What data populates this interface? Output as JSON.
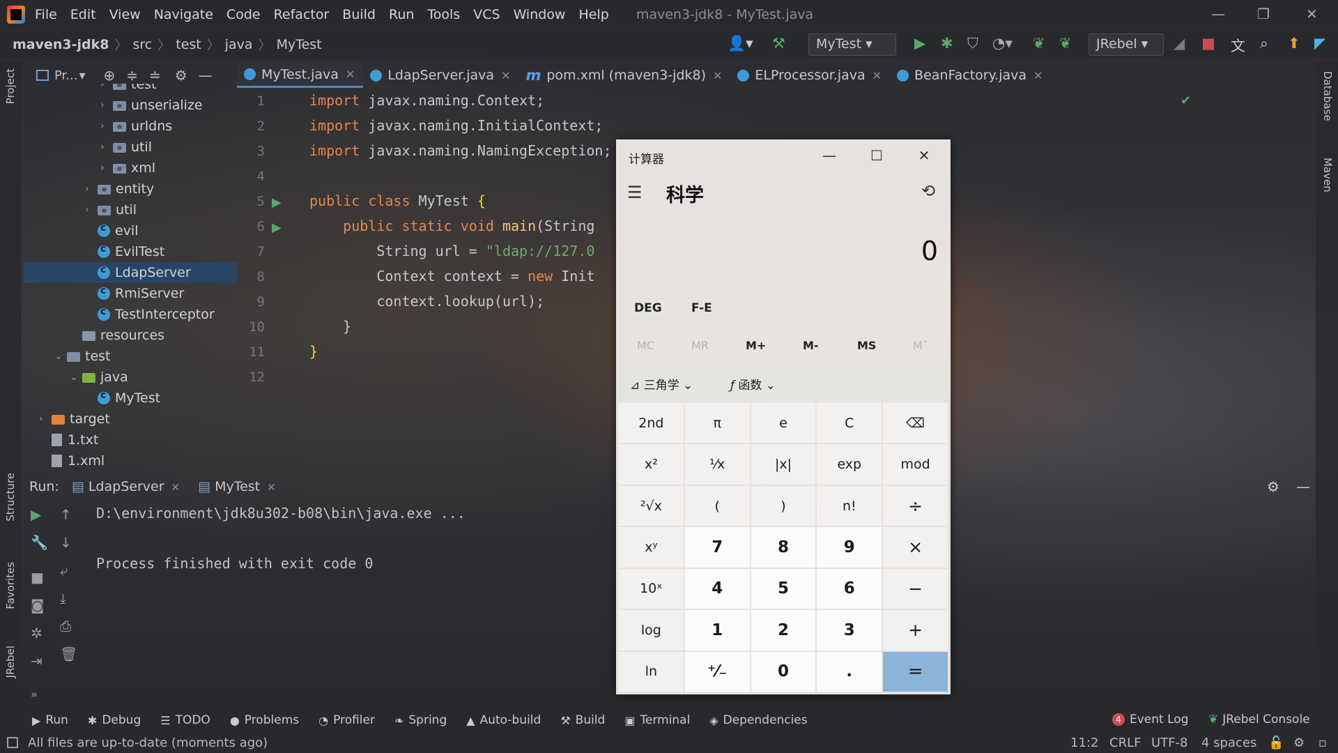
{
  "menubar": {
    "items": [
      "File",
      "Edit",
      "View",
      "Navigate",
      "Code",
      "Refactor",
      "Build",
      "Run",
      "Tools",
      "VCS",
      "Window",
      "Help"
    ],
    "window_title": "maven3-jdk8 - MyTest.java"
  },
  "navbar": {
    "breadcrumbs": [
      "maven3-jdk8",
      "src",
      "test",
      "java",
      "MyTest"
    ],
    "run_config": "MyTest",
    "jrebel_label": "JRebel"
  },
  "left_strip": {
    "project": "Project",
    "structure": "Structure",
    "favorites": "Favorites",
    "jrebel": "JRebel"
  },
  "right_strip": {
    "database": "Database",
    "maven": "Maven"
  },
  "project_panel": {
    "title": "Pr...",
    "tree": [
      {
        "label": "test",
        "kind": "pkg",
        "indent": 3,
        "chev": "›"
      },
      {
        "label": "unserialize",
        "kind": "pkg",
        "indent": 3,
        "chev": "›"
      },
      {
        "label": "urldns",
        "kind": "pkg",
        "indent": 3,
        "chev": "›"
      },
      {
        "label": "util",
        "kind": "pkg",
        "indent": 3,
        "chev": "›"
      },
      {
        "label": "xml",
        "kind": "pkg",
        "indent": 3,
        "chev": "›"
      },
      {
        "label": "entity",
        "kind": "pkg",
        "indent": 2,
        "chev": "›"
      },
      {
        "label": "util",
        "kind": "pkg",
        "indent": 2,
        "chev": "›"
      },
      {
        "label": "evil",
        "kind": "class",
        "indent": 2,
        "chev": ""
      },
      {
        "label": "EvilTest",
        "kind": "class",
        "indent": 2,
        "chev": ""
      },
      {
        "label": "LdapServer",
        "kind": "class",
        "indent": 2,
        "chev": "",
        "selected": true
      },
      {
        "label": "RmiServer",
        "kind": "class",
        "indent": 2,
        "chev": ""
      },
      {
        "label": "TestInterceptor",
        "kind": "class",
        "indent": 2,
        "chev": ""
      },
      {
        "label": "resources",
        "kind": "res",
        "indent": 1,
        "chev": ""
      },
      {
        "label": "test",
        "kind": "folder",
        "indent": 0,
        "chev": "⌄"
      },
      {
        "label": "java",
        "kind": "green",
        "indent": 1,
        "chev": "⌄"
      },
      {
        "label": "MyTest",
        "kind": "class",
        "indent": 2,
        "chev": ""
      },
      {
        "label": "target",
        "kind": "orange",
        "indent": -1,
        "chev": "›"
      },
      {
        "label": "1.txt",
        "kind": "file",
        "indent": -1,
        "chev": ""
      },
      {
        "label": "1.xml",
        "kind": "file",
        "indent": -1,
        "chev": ""
      }
    ]
  },
  "editor": {
    "tabs": [
      {
        "label": "MyTest.java",
        "icon": "class-icon",
        "active": true
      },
      {
        "label": "LdapServer.java",
        "icon": "class-icon"
      },
      {
        "label": "pom.xml (maven3-jdk8)",
        "icon": "maven-icon"
      },
      {
        "label": "ELProcessor.java",
        "icon": "class-icon"
      },
      {
        "label": "BeanFactory.java",
        "icon": "class-icon"
      }
    ],
    "line_numbers": [
      "1",
      "2",
      "3",
      "4",
      "5",
      "6",
      "7",
      "8",
      "9",
      "10",
      "11",
      "12"
    ],
    "lines": [
      {
        "tokens": [
          {
            "t": "import",
            "c": "kw"
          },
          {
            "t": " javax.naming.Context;"
          }
        ]
      },
      {
        "tokens": [
          {
            "t": "import",
            "c": "kw"
          },
          {
            "t": " javax.naming.InitialContext;"
          }
        ]
      },
      {
        "tokens": [
          {
            "t": "import",
            "c": "kw"
          },
          {
            "t": " javax.naming.NamingException;"
          }
        ]
      },
      {
        "tokens": []
      },
      {
        "tokens": [
          {
            "t": "public class",
            "c": "kw"
          },
          {
            "t": " MyTest "
          },
          {
            "t": "{",
            "c": "brace"
          }
        ]
      },
      {
        "tokens": [
          {
            "t": "    public static void",
            "c": "kw"
          },
          {
            "t": " "
          },
          {
            "t": "main",
            "c": "fn"
          },
          {
            "t": "(String"
          }
        ]
      },
      {
        "tokens": [
          {
            "t": "        String url = "
          },
          {
            "t": "\"ldap://127.0",
            "c": "str"
          }
        ]
      },
      {
        "tokens": [
          {
            "t": "        Context context = "
          },
          {
            "t": "new",
            "c": "kw"
          },
          {
            "t": " Init"
          }
        ]
      },
      {
        "tokens": [
          {
            "t": "        context.lookup(url);"
          }
        ]
      },
      {
        "tokens": [
          {
            "t": "    }"
          }
        ]
      },
      {
        "tokens": [
          {
            "t": "}",
            "c": "brace"
          }
        ]
      },
      {
        "tokens": []
      }
    ]
  },
  "run_panel": {
    "label": "Run:",
    "tabs": [
      "LdapServer",
      "MyTest"
    ],
    "console": [
      "D:\\environment\\jdk8u302-b08\\bin\\java.exe ...",
      "",
      "Process finished with exit code 0"
    ]
  },
  "toolwindows": [
    {
      "label": "Run",
      "icon": "▶"
    },
    {
      "label": "Debug",
      "icon": "✱"
    },
    {
      "label": "TODO",
      "icon": "☰"
    },
    {
      "label": "Problems",
      "icon": "●"
    },
    {
      "label": "Profiler",
      "icon": "◔"
    },
    {
      "label": "Spring",
      "icon": "❧"
    },
    {
      "label": "Auto-build",
      "icon": "▲"
    },
    {
      "label": "Build",
      "icon": "⚒"
    },
    {
      "label": "Terminal",
      "icon": "▣"
    },
    {
      "label": "Dependencies",
      "icon": "◈"
    }
  ],
  "event_log": {
    "count": "4",
    "label": "Event Log"
  },
  "jrebel_console": "JRebel Console",
  "status": {
    "message": "All files are up-to-date (moments ago)",
    "position": "11:2",
    "line_sep": "CRLF",
    "encoding": "UTF-8",
    "indent": "4 spaces"
  },
  "calculator": {
    "title": "计算器",
    "mode": "科学",
    "display": "0",
    "angle_mode": "DEG",
    "fe_label": "F-E",
    "memory": [
      "MC",
      "MR",
      "M+",
      "M-",
      "MS",
      "M˅"
    ],
    "trig_label": "三角学",
    "func_label": "函数",
    "keys": [
      "2nd",
      "π",
      "e",
      "C",
      "⌫",
      "x²",
      "¹⁄x",
      "|x|",
      "exp",
      "mod",
      "²√x",
      "(",
      ")",
      "n!",
      "÷",
      "xʸ",
      "7",
      "8",
      "9",
      "×",
      "10ˣ",
      "4",
      "5",
      "6",
      "−",
      "log",
      "1",
      "2",
      "3",
      "+",
      "ln",
      "⁺⁄₋",
      "0",
      ".",
      "="
    ]
  }
}
